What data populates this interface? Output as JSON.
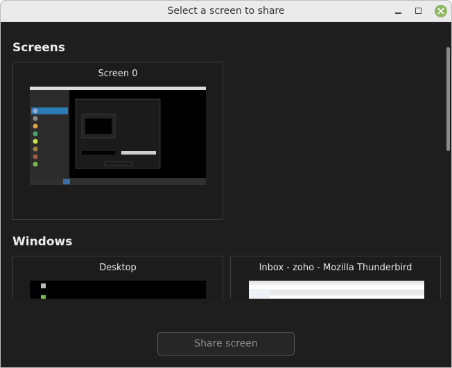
{
  "window": {
    "title": "Select a screen to share"
  },
  "screens": {
    "heading": "Screens",
    "items": [
      {
        "label": "Screen 0"
      }
    ]
  },
  "windows": {
    "heading": "Windows",
    "items": [
      {
        "label": "Desktop"
      },
      {
        "label": "Inbox - zoho - Mozilla Thunderbird"
      }
    ]
  },
  "actions": {
    "share_label": "Share screen"
  },
  "colors": {
    "background": "#1e1e1e",
    "titlebar": "#ebebeb",
    "close_button": "#8fb564",
    "preview_sidebar": "#2b2b2b",
    "preview_accent": "#2a7ab5"
  },
  "icons": [
    "minimize-icon",
    "maximize-icon",
    "close-icon"
  ]
}
